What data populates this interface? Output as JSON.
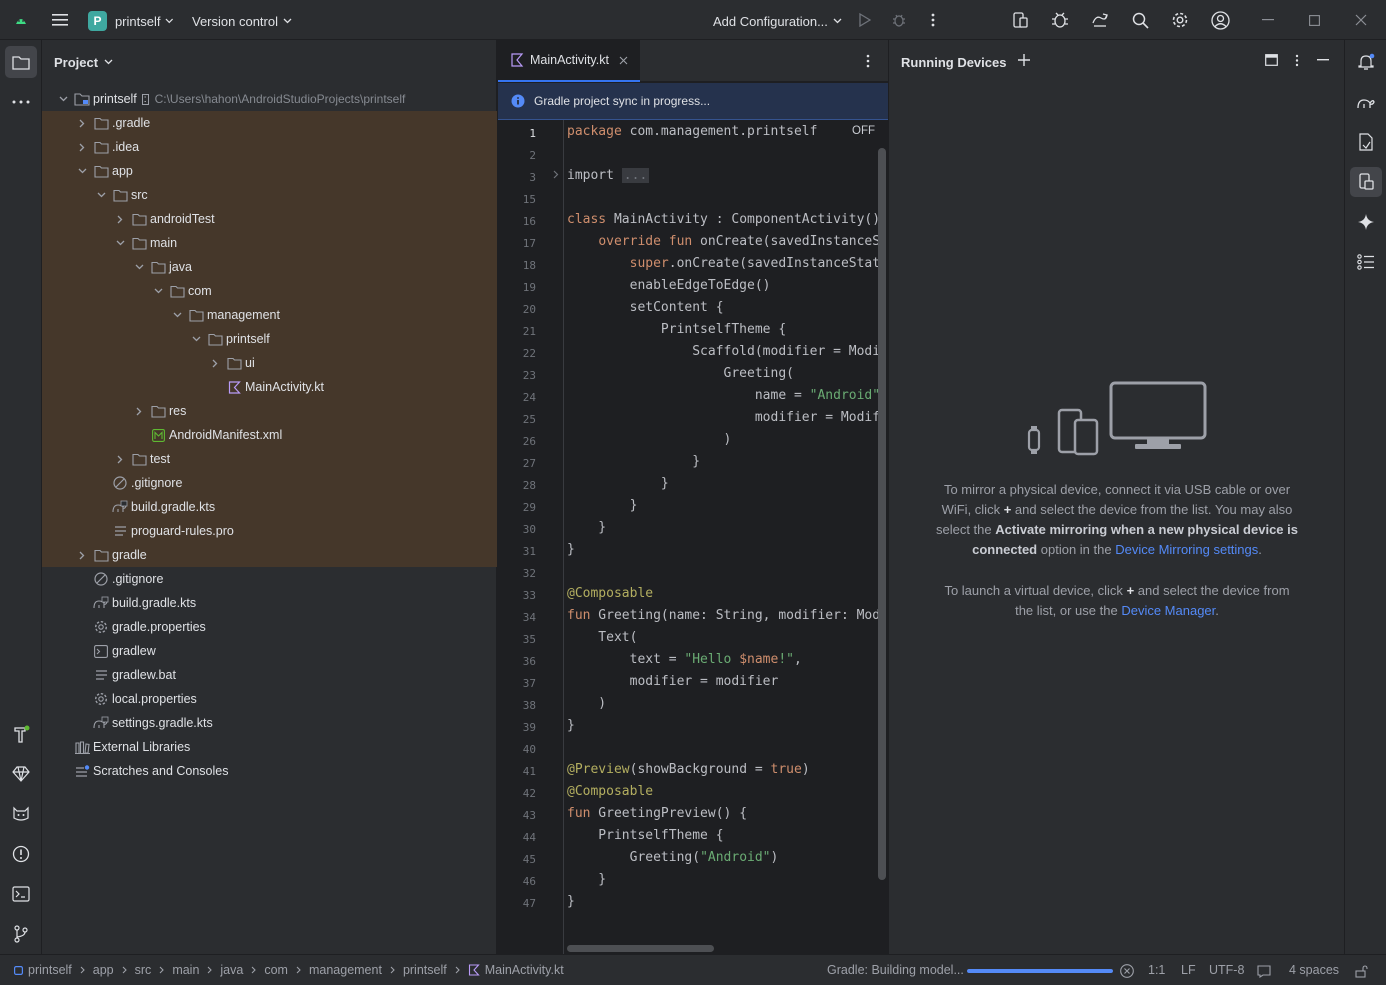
{
  "titlebar": {
    "project_badge": "P",
    "project_name": "printself",
    "vcs_label": "Version control",
    "config_label": "Add Configuration..."
  },
  "project_panel": {
    "title": "Project",
    "root_name": "printself",
    "root_path": "C:\\Users\\hahon\\AndroidStudioProjects\\printself",
    "items": [
      {
        "label": ".gradle"
      },
      {
        "label": ".idea"
      },
      {
        "label": "app"
      },
      {
        "label": "src"
      },
      {
        "label": "androidTest"
      },
      {
        "label": "main"
      },
      {
        "label": "java"
      },
      {
        "label": "com"
      },
      {
        "label": "management"
      },
      {
        "label": "printself"
      },
      {
        "label": "ui"
      },
      {
        "label": "MainActivity.kt"
      },
      {
        "label": "res"
      },
      {
        "label": "AndroidManifest.xml"
      },
      {
        "label": "test"
      },
      {
        "label": ".gitignore"
      },
      {
        "label": "build.gradle.kts"
      },
      {
        "label": "proguard-rules.pro"
      },
      {
        "label": "gradle"
      },
      {
        "label": ".gitignore"
      },
      {
        "label": "build.gradle.kts"
      },
      {
        "label": "gradle.properties"
      },
      {
        "label": "gradlew"
      },
      {
        "label": "gradlew.bat"
      },
      {
        "label": "local.properties"
      },
      {
        "label": "settings.gradle.kts"
      },
      {
        "label": "External Libraries"
      },
      {
        "label": "Scratches and Consoles"
      }
    ]
  },
  "editor": {
    "tab_label": "MainActivity.kt",
    "banner": "Gradle project sync in progress...",
    "off_badge": "OFF",
    "line_numbers": [
      "1",
      "2",
      "3",
      "15",
      "16",
      "17",
      "18",
      "19",
      "20",
      "21",
      "22",
      "23",
      "24",
      "25",
      "26",
      "27",
      "28",
      "29",
      "30",
      "31",
      "32",
      "33",
      "34",
      "35",
      "36",
      "37",
      "38",
      "39",
      "40",
      "41",
      "42",
      "43",
      "44",
      "45",
      "46",
      "47"
    ]
  },
  "devices": {
    "title": "Running Devices",
    "p1_a": "To mirror a physical device, connect it via USB cable or over",
    "p1_b1": "WiFi, click",
    "p1_b2": "and select the device from the list. You may also",
    "p1_c1": "select the",
    "p1_c2": "Activate mirroring when a new physical device is",
    "p1_d1": "connected",
    "p1_d2": "option in the",
    "p1_d3": "Device Mirroring settings",
    "p1_d4": ".",
    "p2_a1": "To launch a virtual device, click",
    "p2_a2": "and select the device from",
    "p2_b1": "the list, or use the",
    "p2_b2": "Device Manager",
    "p2_b3": "."
  },
  "statusbar": {
    "breadcrumbs": [
      "printself",
      "app",
      "src",
      "main",
      "java",
      "com",
      "management",
      "printself",
      "MainActivity.kt"
    ],
    "gradle_status": "Gradle: Building model...",
    "progress": 1.0,
    "position": "1:1",
    "line_sep": "LF",
    "encoding": "UTF-8",
    "indent": "4 spaces"
  },
  "colors": {
    "accent": "#3574f0",
    "highlight_row": "#45372a",
    "keyword": "#cf8e6d",
    "string": "#6aab73",
    "annotation": "#b3ae60"
  }
}
